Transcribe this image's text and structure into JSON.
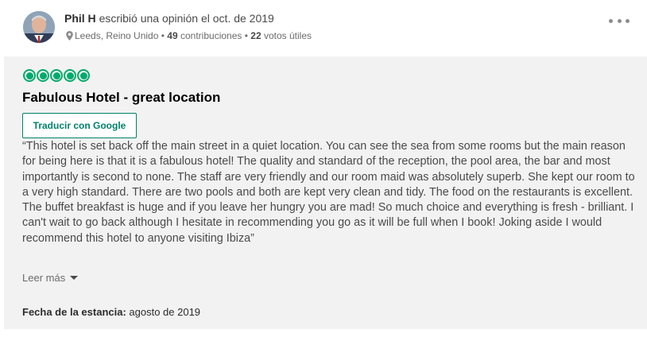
{
  "reviewer": {
    "name": "Phil H",
    "action_text": "escribió una opinión el oct. de 2019",
    "location": "Leeds, Reino Unido",
    "separator": "•",
    "contributions_count": "49",
    "contributions_label": "contribuciones",
    "helpful_votes_count": "22",
    "helpful_votes_label": "votos útiles"
  },
  "review": {
    "rating": 5,
    "rating_max": 5,
    "title": "Fabulous Hotel - great location",
    "translate_label": "Traducir con Google",
    "text": "“This hotel is set back off the main street in a quiet location. You can see the sea from some rooms but the main reason for being here is that it is a fabulous hotel! The quality and standard of the reception, the pool area, the bar and most importantly is second to none. The staff are very friendly and our room maid was absolutely superb. She kept our room to a very high standard. There are two pools and both are kept very clean and tidy. The food on the restaurants is excellent. The buffet breakfast is huge and if you leave her hungry you are mad! So much choice and everything is fresh - brilliant. I can't wait to go back although I hesitate in recommending you go as it will be full when I book! Joking aside I would recommend this hotel to anyone visiting Ibiza”",
    "read_more_label": "Leer más",
    "stay_date_label": "Fecha de la estancia:",
    "stay_date_value": "agosto de 2019"
  },
  "icons": {
    "location": "map-pin-icon",
    "more": "more-options-icon",
    "read_more": "caret-down-icon",
    "rating": "rating-bubble-icon"
  },
  "colors": {
    "rating_green": "#00aa6c",
    "translate_border": "#00806c",
    "card_background": "#f2f2f2"
  }
}
